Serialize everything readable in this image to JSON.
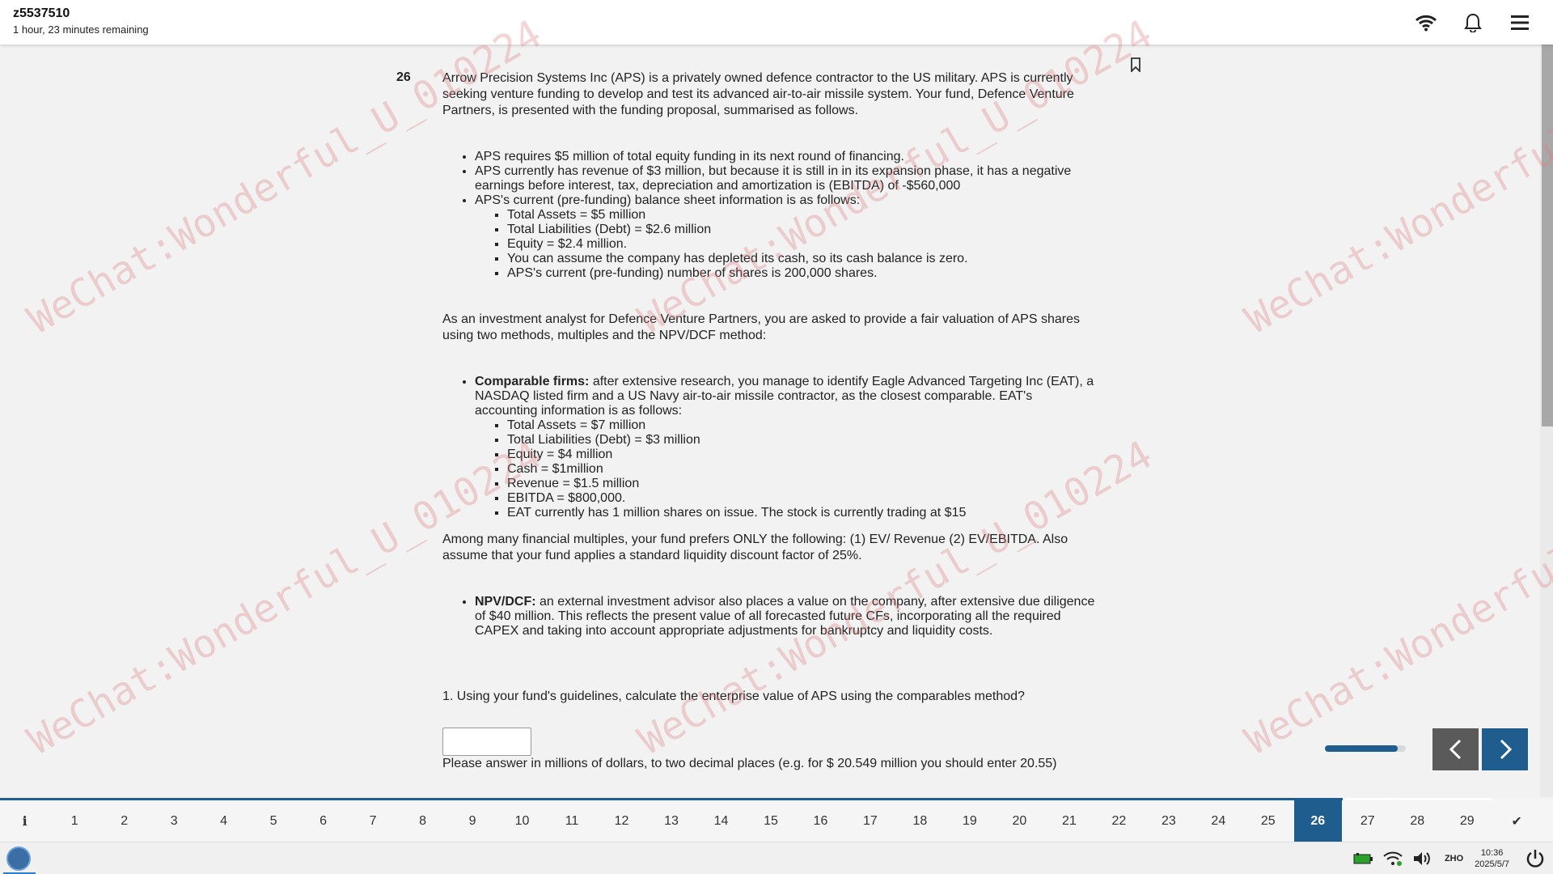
{
  "header": {
    "user_id": "z5537510",
    "time_remaining": "1 hour, 23 minutes remaining"
  },
  "icons": {
    "wifi": "wifi-icon",
    "notifications": "bell-icon",
    "menu": "hamburger-menu-icon",
    "bookmark": "bookmark-icon",
    "prev": "chevron-left-icon",
    "next": "chevron-right-icon",
    "info": "info-icon",
    "finish": "checkmark-icon"
  },
  "question": {
    "number": "26",
    "intro": "Arrow Precision Systems Inc (APS) is a privately owned defence contractor to the US military. APS is currently seeking venture funding to develop and test its advanced air-to-air missile system. Your fund, Defence Venture Partners, is presented with the funding proposal, summarised as follows.",
    "aps_bullets": [
      "APS requires $5 million of total equity funding in its next round of financing.",
      "APS currently has revenue of $3 million, but because it is still in in its expansion phase, it has a negative earnings before interest, tax, depreciation and amortization is (EBITDA) of  -$560,000",
      "APS's current (pre-funding) balance sheet information is as follows:"
    ],
    "aps_balance": [
      "Total Assets = $5 million",
      "Total Liabilities (Debt) = $2.6 million",
      "Equity = $2.4 million.",
      "You can assume the company has depleted its cash, so its cash balance is zero.",
      "APS's current (pre-funding) number of shares is 200,000 shares."
    ],
    "task": "As an investment analyst for Defence Venture Partners, you are asked to provide a fair valuation of APS shares using two methods, multiples and the NPV/DCF method:",
    "comparables_label": "Comparable firms:",
    "comparables_text": " after extensive research, you manage to identify Eagle Advanced Targeting Inc (EAT), a NASDAQ listed firm and a US Navy air-to-air missile contractor, as the closest comparable. EAT's accounting information is as follows:",
    "eat_info": [
      "Total Assets = $7 million",
      "Total Liabilities (Debt) = $3 million",
      "Equity = $4 million",
      "Cash = $1million",
      "Revenue = $1.5 million",
      "EBITDA = $800,000.",
      "EAT currently has 1 million shares on issue. The stock is currently trading at $15"
    ],
    "multiples": "Among many financial multiples, your fund prefers ONLY the following:  (1) EV/ Revenue (2) EV/EBITDA. Also assume that your fund applies a standard liquidity discount factor of 25%.",
    "npv_label": "NPV/DCF:",
    "npv_text": " an external investment advisor also places a value on the company, after extensive due diligence of $40 million. This reflects the present value of all forecasted future CFs, incorporating all the required CAPEX and taking into account appropriate adjustments for bankruptcy and liquidity costs.",
    "sub_question": "1. Using your fund's guidelines, calculate the enterprise value of APS using the comparables method?",
    "answer_value": "",
    "answer_hint": "Please answer in millions of dollars, to two decimal places (e.g. for $ 20.549 million you should enter 20.55)"
  },
  "progress": {
    "fraction": 0.9
  },
  "question_nav": {
    "items": [
      "1",
      "2",
      "3",
      "4",
      "5",
      "6",
      "7",
      "8",
      "9",
      "10",
      "11",
      "12",
      "13",
      "14",
      "15",
      "16",
      "17",
      "18",
      "19",
      "20",
      "21",
      "22",
      "23",
      "24",
      "25",
      "26",
      "27",
      "28",
      "29"
    ],
    "current": "26",
    "info_symbol": "i",
    "finish_symbol": "✔"
  },
  "taskbar": {
    "language": "ZHO",
    "time": "10:36",
    "date": "2025/5/7"
  },
  "watermark": {
    "text": "WeChat:Wonderful_U_010224"
  },
  "colors": {
    "accent": "#1f5d8e",
    "prev_button": "#5a5a5a",
    "watermark": "#dc7878"
  }
}
